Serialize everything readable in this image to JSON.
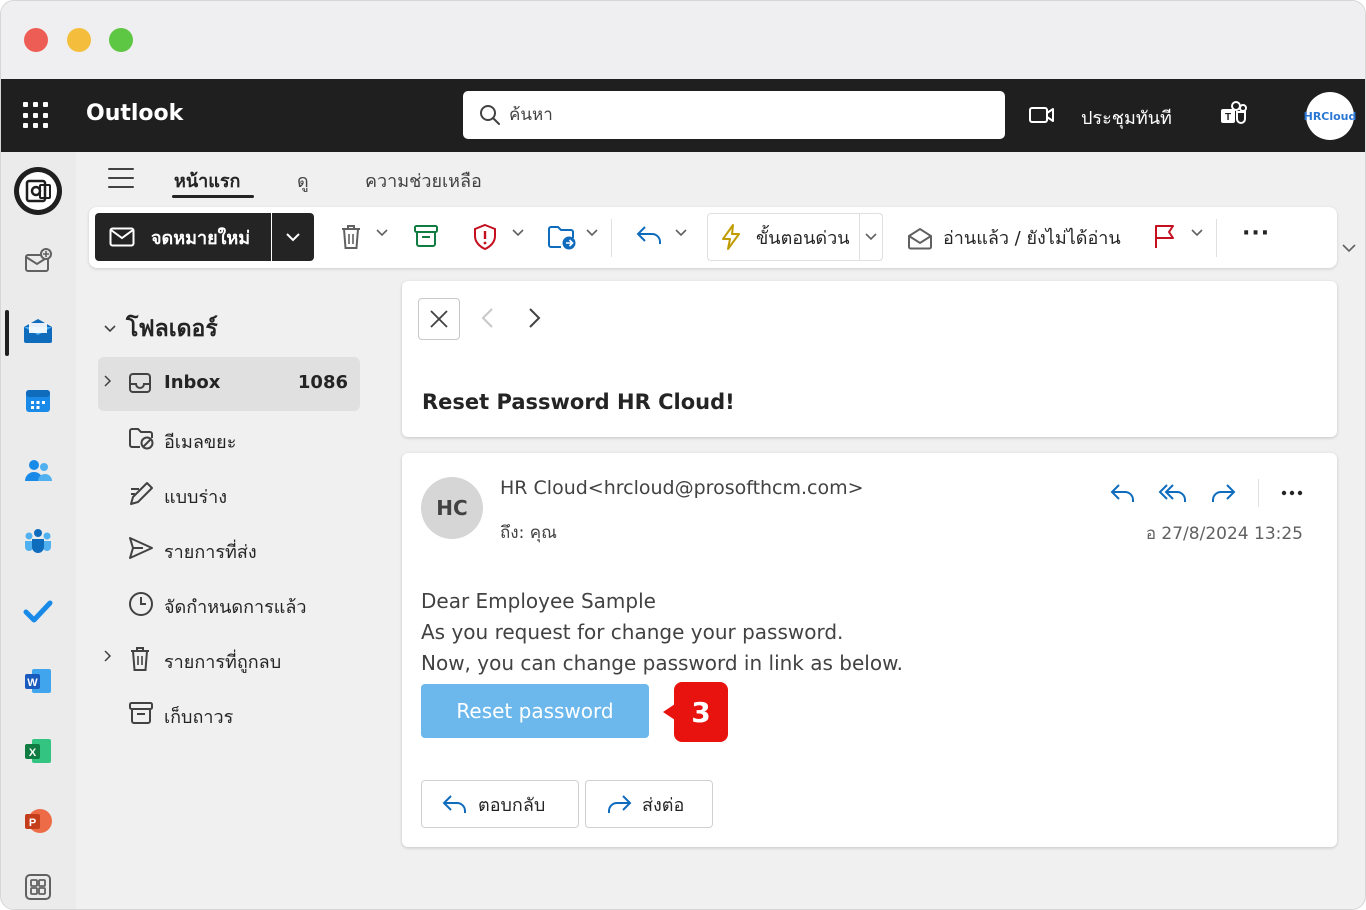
{
  "header": {
    "app_name": "Outlook",
    "search_placeholder": "ค้นหา",
    "meet_now_label": "ประชุมทันที",
    "avatar_text": "HRCloud"
  },
  "tabs": [
    {
      "label": "หน้าแรก",
      "active": true
    },
    {
      "label": "ดู",
      "active": false
    },
    {
      "label": "ความช่วยเหลือ",
      "active": false
    }
  ],
  "ribbon": {
    "new_mail_label": "จดหมายใหม่",
    "quick_steps_label": "ขั้นตอนด่วน",
    "read_unread_label": "อ่านแล้ว / ยังไม่ได้อ่าน",
    "more_label": "···"
  },
  "folders": {
    "title": "โฟลเดอร์",
    "items": [
      {
        "label": "Inbox",
        "count": "1086",
        "icon": "inbox-icon"
      },
      {
        "label": "อีเมลขยะ",
        "count": "",
        "icon": "junk-icon"
      },
      {
        "label": "แบบร่าง",
        "count": "",
        "icon": "drafts-icon"
      },
      {
        "label": "รายการที่ส่ง",
        "count": "",
        "icon": "sent-icon"
      },
      {
        "label": "จัดกำหนดการแล้ว",
        "count": "",
        "icon": "scheduled-icon"
      },
      {
        "label": "รายการที่ถูกลบ",
        "count": "",
        "icon": "deleted-icon"
      },
      {
        "label": "เก็บถาวร",
        "count": "",
        "icon": "archive-icon"
      }
    ]
  },
  "message": {
    "subject": "Reset Password HR Cloud!",
    "avatar_initials": "HC",
    "sender": "HR Cloud<hrcloud@prosofthcm.com>",
    "to_line": "ถึง:  คุณ",
    "date": "อ 27/8/2024 13:25",
    "body": {
      "line1": "Dear Employee Sample",
      "line2": "As you request for change your password.",
      "line3": "Now, you can change password in link as below."
    },
    "reset_button_label": "Reset password",
    "step_badge": "3",
    "reply_label": "ตอบกลับ",
    "forward_label": "ส่งต่อ"
  },
  "colors": {
    "header_bg": "#1f1f1f",
    "accent_blue": "#0f6cbd",
    "reset_button": "#6cb8ec",
    "step_badge": "#e8120f"
  }
}
